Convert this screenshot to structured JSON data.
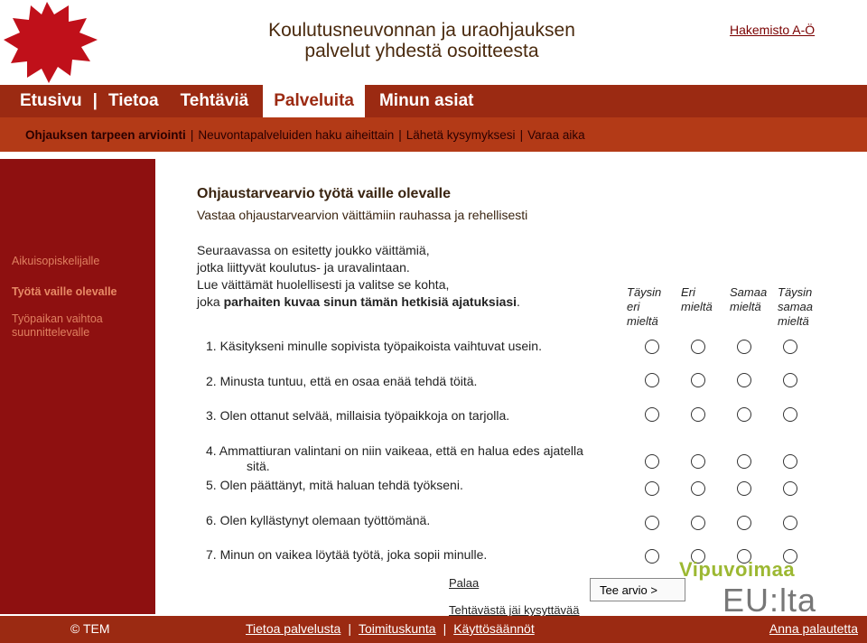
{
  "header": {
    "title_line1": "Koulutusneuvonnan ja uraohjauksen",
    "title_line2": "palvelut yhdestä osoitteesta",
    "index_link": "Hakemisto A-Ö"
  },
  "main_nav": {
    "items": [
      "Etusivu",
      "Tietoa",
      "Tehtäviä",
      "Palveluita",
      "Minun asiat"
    ],
    "separator": "|",
    "active": "Palveluita"
  },
  "sub_nav": {
    "items": [
      "Ohjauksen tarpeen arviointi",
      "Neuvontapalveluiden haku aiheittain",
      "Lähetä kysymyksesi",
      "Varaa aika"
    ],
    "separator": "|"
  },
  "sidebar": {
    "items": [
      "Aikuisopiskelijalle",
      "Työtä vaille olevalle",
      "Työpaikan vaihtoa",
      "suunnittelevalle"
    ]
  },
  "content": {
    "title": "Ohjaustarvearvio työtä vaille olevalle",
    "subtitle": "Vastaa ohjaustarvearvion väittämiin rauhassa ja rehellisesti",
    "intro_line1": "Seuraavassa on esitetty joukko väittämiä,",
    "intro_line2": "jotka liittyvät koulutus- ja uravalintaan.",
    "intro_line3": "Lue väittämät huolellisesti ja valitse se kohta,",
    "intro_line4_pre": "joka ",
    "intro_line4_bold": "parhaiten kuvaa sinun tämän hetkisiä ajatuksiasi",
    "intro_line4_post": "."
  },
  "scale": {
    "col1": [
      "Täysin",
      "eri",
      "mieltä"
    ],
    "col2": [
      "Eri",
      "mieltä"
    ],
    "col3": [
      "Samaa",
      "mieltä"
    ],
    "col4": [
      "Täysin",
      "samaa",
      "mieltä"
    ]
  },
  "questions": [
    {
      "text": "1. Käsitykseni minulle sopivista työpaikoista vaihtuvat usein.",
      "wrap": ""
    },
    {
      "text": "2. Minusta tuntuu, että en osaa enää tehdä töitä.",
      "wrap": ""
    },
    {
      "text": "3. Olen ottanut selvää, millaisia työpaikkoja on tarjolla.",
      "wrap": ""
    },
    {
      "text": "4. Ammattiuran valintani on niin vaikeaa, että en halua edes ajatella",
      "wrap": "sitä."
    },
    {
      "text": "5. Olen päättänyt, mitä haluan tehdä työkseni.",
      "wrap": ""
    },
    {
      "text": "6. Olen kyllästynyt olemaan työttömänä.",
      "wrap": ""
    },
    {
      "text": "7. Minun on vaikea löytää työtä, joka sopii minulle.",
      "wrap": ""
    }
  ],
  "actions": {
    "back": "Palaa",
    "back_task": "Tehtävästä jäi kysyttävää",
    "submit": "Tee arvio >"
  },
  "eu_logo": {
    "top": "Vipuvoimaa",
    "bottom": "EU:lta"
  },
  "footer": {
    "copyright": "© TEM",
    "links": [
      "Tietoa palvelusta",
      "Toimituskunta",
      "Käyttösäännöt"
    ],
    "separator": "|",
    "feedback": "Anna palautetta"
  },
  "colors": {
    "nav_bg": "#9b2a12",
    "subnav_bg": "#b33a17",
    "sidebar_bg": "#8e1010",
    "star_red": "#c0101a"
  }
}
